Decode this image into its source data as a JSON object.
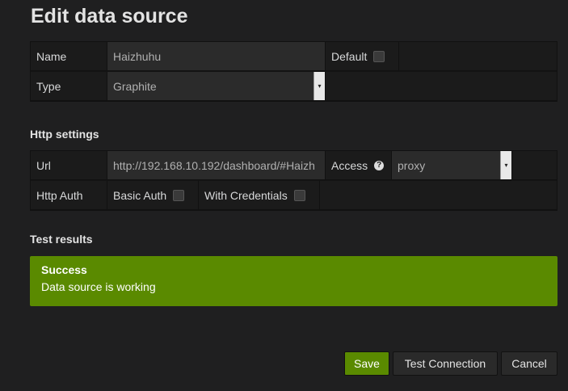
{
  "page": {
    "title": "Edit data source"
  },
  "general": {
    "name_label": "Name",
    "name_value": "Haizhuhu",
    "default_label": "Default",
    "type_label": "Type",
    "type_value": "Graphite"
  },
  "http": {
    "section_title": "Http settings",
    "url_label": "Url",
    "url_value": "http://192.168.10.192/dashboard/#Haizh",
    "access_label": "Access",
    "access_value": "proxy",
    "auth_label": "Http Auth",
    "basic_auth_label": "Basic Auth",
    "with_credentials_label": "With Credentials"
  },
  "test": {
    "section_title": "Test results",
    "status": "Success",
    "message": "Data source is working"
  },
  "buttons": {
    "save": "Save",
    "test_connection": "Test Connection",
    "cancel": "Cancel"
  },
  "colors": {
    "success": "#5a8a00",
    "background": "#1f1f20"
  },
  "icons": {
    "help": "question-circle-icon",
    "dropdown": "caret-down-icon"
  }
}
